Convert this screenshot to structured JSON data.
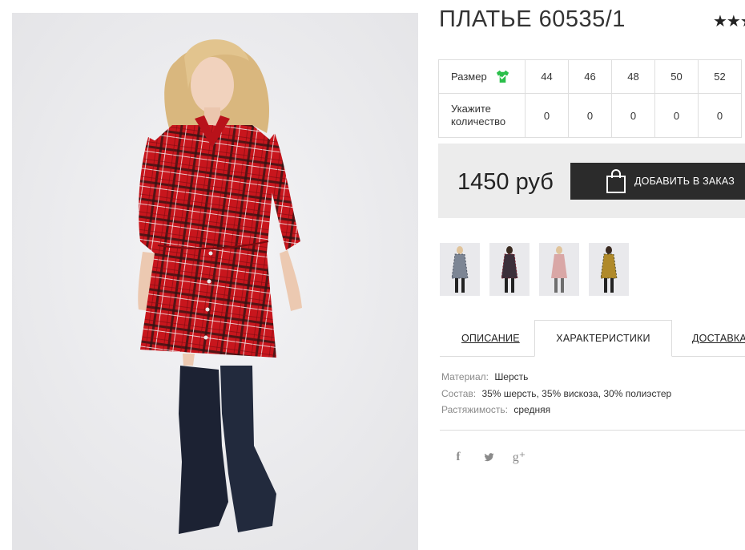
{
  "product": {
    "title": "ПЛАТЬЕ 60535/1",
    "rating_stars": "★★★"
  },
  "sizes": {
    "row_label_size": "Размер",
    "row_label_qty_1": "Укажите",
    "row_label_qty_2": "количество",
    "values": [
      "44",
      "46",
      "48",
      "50",
      "52"
    ],
    "quantities": [
      "0",
      "0",
      "0",
      "0",
      "0"
    ]
  },
  "price": {
    "text": "1450 руб",
    "add_button": "ДОБАВИТЬ В ЗАКАЗ"
  },
  "thumbnails": [
    {
      "name": "grey-plaid"
    },
    {
      "name": "dark-plaid"
    },
    {
      "name": "pink"
    },
    {
      "name": "yellow-plaid"
    }
  ],
  "tabs": {
    "description": "ОПИСАНИЕ",
    "characteristics": "ХАРАКТЕРИСТИКИ",
    "delivery": "ДОСТАВКА"
  },
  "specs": {
    "material_label": "Материал:",
    "material_value": "Шерсть",
    "composition_label": "Состав:",
    "composition_value": "35% шерсть, 35% вискоза, 30% полиэстер",
    "stretch_label": "Растяжимость:",
    "stretch_value": "средняя"
  },
  "social": {
    "facebook": "f",
    "gplus": "g⁺"
  },
  "colors": {
    "button_bg": "#2b2b2b",
    "price_bg": "#ececec",
    "accent_green": "#2bbf4a",
    "dress_red": "#c8161d"
  }
}
